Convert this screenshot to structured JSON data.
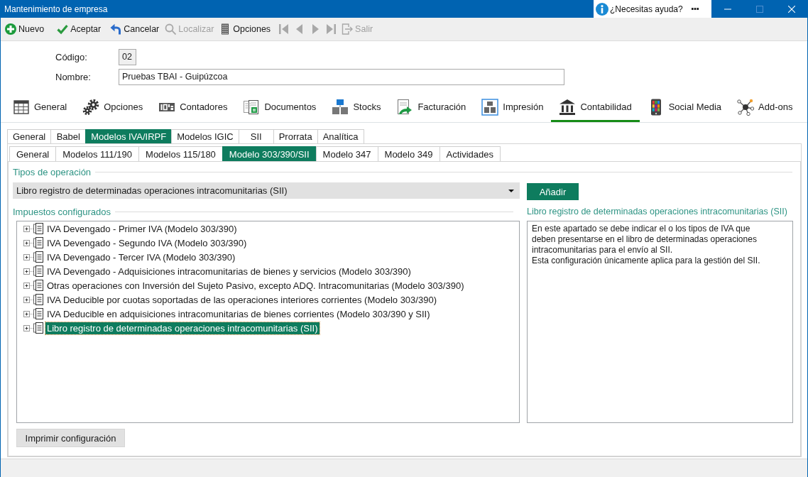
{
  "window": {
    "title": "Mantenimiento de empresa",
    "help": "¿Necesitas ayuda?",
    "controls": [
      {
        "kind": "minimize",
        "disabled": false
      },
      {
        "kind": "maximize",
        "disabled": true
      },
      {
        "kind": "close",
        "disabled": false
      }
    ]
  },
  "toolbar": [
    {
      "kind": "new",
      "label": "Nuevo",
      "disabled": false
    },
    {
      "kind": "accept",
      "label": "Aceptar",
      "disabled": false
    },
    {
      "kind": "cancel",
      "label": "Cancelar",
      "disabled": false
    },
    {
      "kind": "find",
      "label": "Localizar",
      "disabled": true
    },
    {
      "kind": "options",
      "label": "Opciones",
      "disabled": false
    },
    {
      "kind": "first",
      "disabled": true
    },
    {
      "kind": "previous",
      "disabled": true
    },
    {
      "kind": "next",
      "disabled": true
    },
    {
      "kind": "last",
      "disabled": true
    },
    {
      "kind": "exit",
      "label": "Salir",
      "disabled": true
    }
  ],
  "fields": [
    {
      "kind": "code",
      "label": "Código:",
      "value": "02",
      "readonly": true
    },
    {
      "kind": "text",
      "label": "Nombre:",
      "value": "Pruebas TBAI - Guipúzcoa",
      "readonly": false
    }
  ],
  "main_tabs": [
    {
      "kind": "table",
      "label": "General",
      "selected": false
    },
    {
      "kind": "gears",
      "label": "Opciones",
      "selected": false
    },
    {
      "kind": "counter",
      "label": "Contadores",
      "selected": false
    },
    {
      "kind": "documents",
      "label": "Documentos",
      "selected": false
    },
    {
      "kind": "boxes",
      "label": "Stocks",
      "selected": false
    },
    {
      "kind": "invoice",
      "label": "Facturación",
      "selected": false
    },
    {
      "kind": "layout",
      "label": "Impresión",
      "selected": false
    },
    {
      "kind": "bank",
      "label": "Contabilidad",
      "selected": true
    },
    {
      "kind": "phone",
      "label": "Social Media",
      "selected": false
    },
    {
      "kind": "network",
      "label": "Add-ons",
      "selected": false
    }
  ],
  "section_tabs": [
    {
      "label": "General",
      "selected": false
    },
    {
      "label": "Babel",
      "selected": false
    },
    {
      "label": "Modelos IVA/IRPF",
      "selected": true
    },
    {
      "label": "Modelos IGIC",
      "selected": false
    },
    {
      "label": "SII",
      "selected": false
    },
    {
      "label": "Prorrata",
      "selected": false
    },
    {
      "label": "Analítica",
      "selected": false
    }
  ],
  "model_tabs": [
    {
      "label": "General",
      "selected": false
    },
    {
      "label": "Modelos 111/190",
      "selected": false
    },
    {
      "label": "Modelos 115/180",
      "selected": false
    },
    {
      "label": "Modelo 303/390/SII",
      "selected": true
    },
    {
      "label": "Modelo 347",
      "selected": false
    },
    {
      "label": "Modelo 349",
      "selected": false
    },
    {
      "label": "Actividades",
      "selected": false
    }
  ],
  "operation_types": {
    "title": "Tipos de operación",
    "value": "Libro registro de determinadas operaciones intracomunitarias (SII)",
    "button": "Añadir"
  },
  "taxes": {
    "title": "Impuestos configurados",
    "items": [
      {
        "label": "IVA Devengado - Primer IVA (Modelo 303/390)",
        "expanded": false,
        "selected": false
      },
      {
        "label": "IVA Devengado - Segundo IVA (Modelo 303/390)",
        "expanded": false,
        "selected": false
      },
      {
        "label": "IVA Devengado - Tercer IVA (Modelo 303/390)",
        "expanded": false,
        "selected": false
      },
      {
        "label": "IVA Devengado - Adquisiciones intracomunitarias de bienes y servicios (Modelo 303/390)",
        "expanded": false,
        "selected": false
      },
      {
        "label": "Otras operaciones con Inversión del Sujeto Pasivo, excepto ADQ. Intracomunitarias (Modelo 303/390)",
        "expanded": false,
        "selected": false
      },
      {
        "label": "IVA Deducible por cuotas soportadas de las operaciones interiores corrientes (Modelo 303/390)",
        "expanded": false,
        "selected": false
      },
      {
        "label": "IVA Deducible en adquisiciones intracomunitarias de bienes corrientes (Modelo 303/390 y SII)",
        "expanded": false,
        "selected": false
      },
      {
        "label": "Libro registro de determinadas operaciones intracomunitarias (SII)",
        "expanded": false,
        "selected": true
      }
    ]
  },
  "description": {
    "title": "Libro registro de determinadas operaciones intracomunitarias (SII)",
    "paragraphs": [
      "En este apartado se debe indicar el o los tipos de IVA que deben presentarse en el libro de determinadas operaciones intracomunitarias para el envío al SII.",
      "Esta configuración únicamente aplica para la gestión del SII."
    ]
  },
  "print_button": "Imprimir configuración"
}
